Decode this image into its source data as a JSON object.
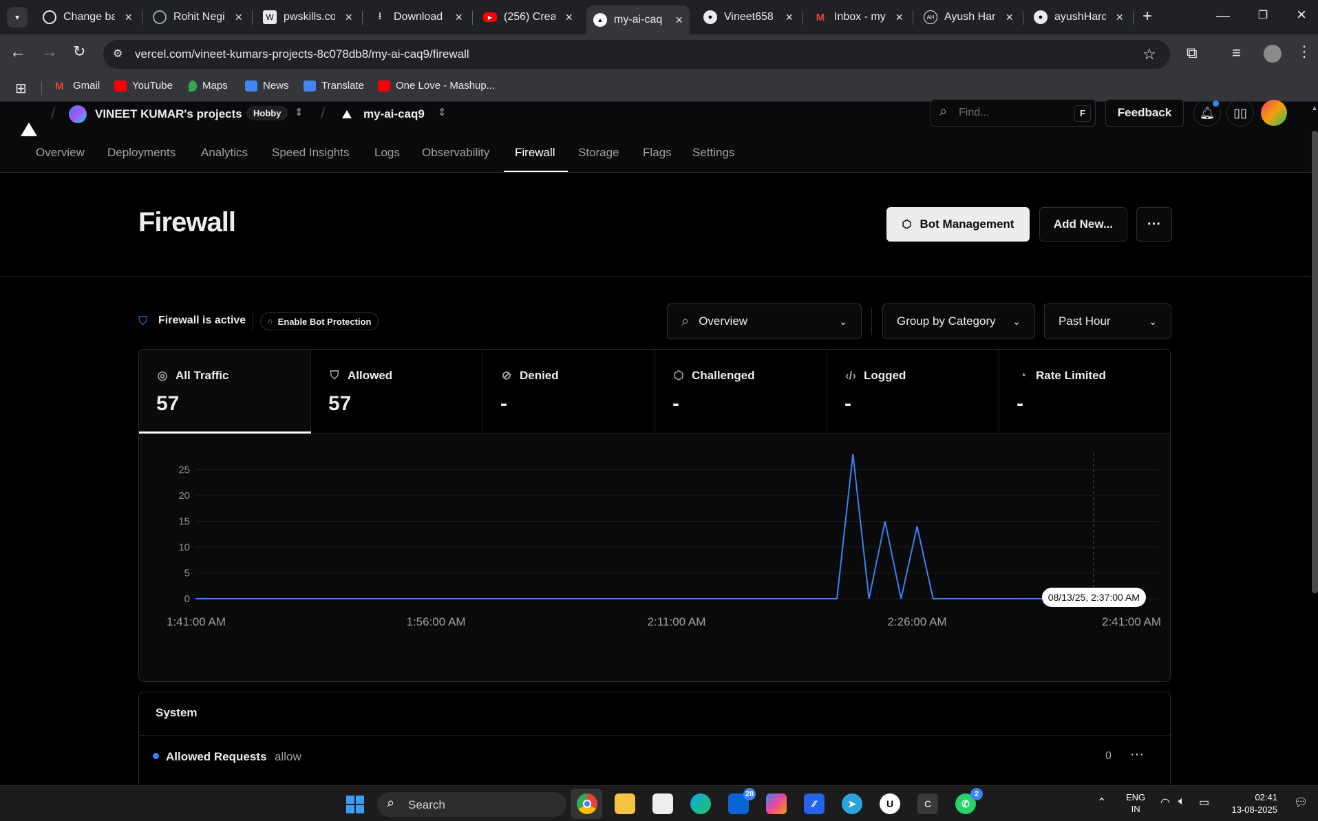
{
  "browser": {
    "tabs": [
      {
        "title": "Change ba",
        "icon": "chatgpt-icon"
      },
      {
        "title": "Rohit Negi",
        "icon": "globe-icon"
      },
      {
        "title": "pwskills.co",
        "icon": "pwskills-icon"
      },
      {
        "title": "Download",
        "icon": "download-icon"
      },
      {
        "title": "(256) Creat",
        "icon": "youtube-icon"
      },
      {
        "title": "my-ai-caq",
        "icon": "vercel-icon"
      },
      {
        "title": "Vineet658",
        "icon": "github-icon"
      },
      {
        "title": "Inbox - my",
        "icon": "gmail-icon"
      },
      {
        "title": "Ayush Har",
        "icon": "ah-icon"
      },
      {
        "title": "ayushHard",
        "icon": "github-icon"
      }
    ],
    "url": "vercel.com/vineet-kumars-projects-8c078db8/my-ai-caq9/firewall",
    "bookmarks": [
      "Gmail",
      "YouTube",
      "Maps",
      "News",
      "Translate",
      "One Love - Mashup..."
    ]
  },
  "header": {
    "team": "VINEET KUMAR's projects",
    "plan": "Hobby",
    "project": "my-ai-caq9",
    "find_placeholder": "Find...",
    "find_shortcut": "F",
    "feedback": "Feedback",
    "nav": [
      "Overview",
      "Deployments",
      "Analytics",
      "Speed Insights",
      "Logs",
      "Observability",
      "Firewall",
      "Storage",
      "Flags",
      "Settings"
    ],
    "active_nav": "Firewall"
  },
  "page": {
    "title": "Firewall",
    "bot_management": "Bot Management",
    "add_new": "Add New...",
    "status": "Firewall is active",
    "enable_bot": "Enable Bot Protection",
    "filter_view": "Overview",
    "group_by": "Group by Category",
    "time_range": "Past Hour"
  },
  "stats": [
    {
      "label": "All Traffic",
      "value": "57",
      "icon": "globe-icon"
    },
    {
      "label": "Allowed",
      "value": "57",
      "icon": "shield-check-icon"
    },
    {
      "label": "Denied",
      "value": "-",
      "icon": "shield-off-icon"
    },
    {
      "label": "Challenged",
      "value": "-",
      "icon": "shield-icon"
    },
    {
      "label": "Logged",
      "value": "-",
      "icon": "code-icon"
    },
    {
      "label": "Rate Limited",
      "value": "-",
      "icon": "gauge-icon"
    }
  ],
  "chart_data": {
    "type": "line",
    "x_ticks": [
      "1:41:00 AM",
      "1:56:00 AM",
      "2:11:00 AM",
      "2:26:00 AM",
      "2:41:00 AM"
    ],
    "y_ticks": [
      0,
      5,
      10,
      15,
      20,
      25
    ],
    "ylim": [
      0,
      28
    ],
    "x_minutes_range": [
      0,
      60
    ],
    "series": [
      {
        "color": "#3b82f6",
        "points": [
          [
            0,
            0
          ],
          [
            40,
            0
          ],
          [
            41,
            28
          ],
          [
            42,
            0
          ],
          [
            43,
            15
          ],
          [
            44,
            0
          ],
          [
            45,
            14
          ],
          [
            46,
            0
          ],
          [
            53,
            0
          ]
        ]
      }
    ],
    "tooltip": "08/13/25, 2:37:00 AM",
    "cursor_minute": 56
  },
  "system": {
    "title": "System",
    "rows": [
      {
        "name": "Allowed Requests",
        "action": "allow",
        "count": "0"
      }
    ]
  },
  "taskbar": {
    "search": "Search",
    "lang": "ENG",
    "region": "IN",
    "time": "02:41",
    "date": "13-08-2025",
    "outlook_badge": "28",
    "whatsapp_badge": "2"
  }
}
